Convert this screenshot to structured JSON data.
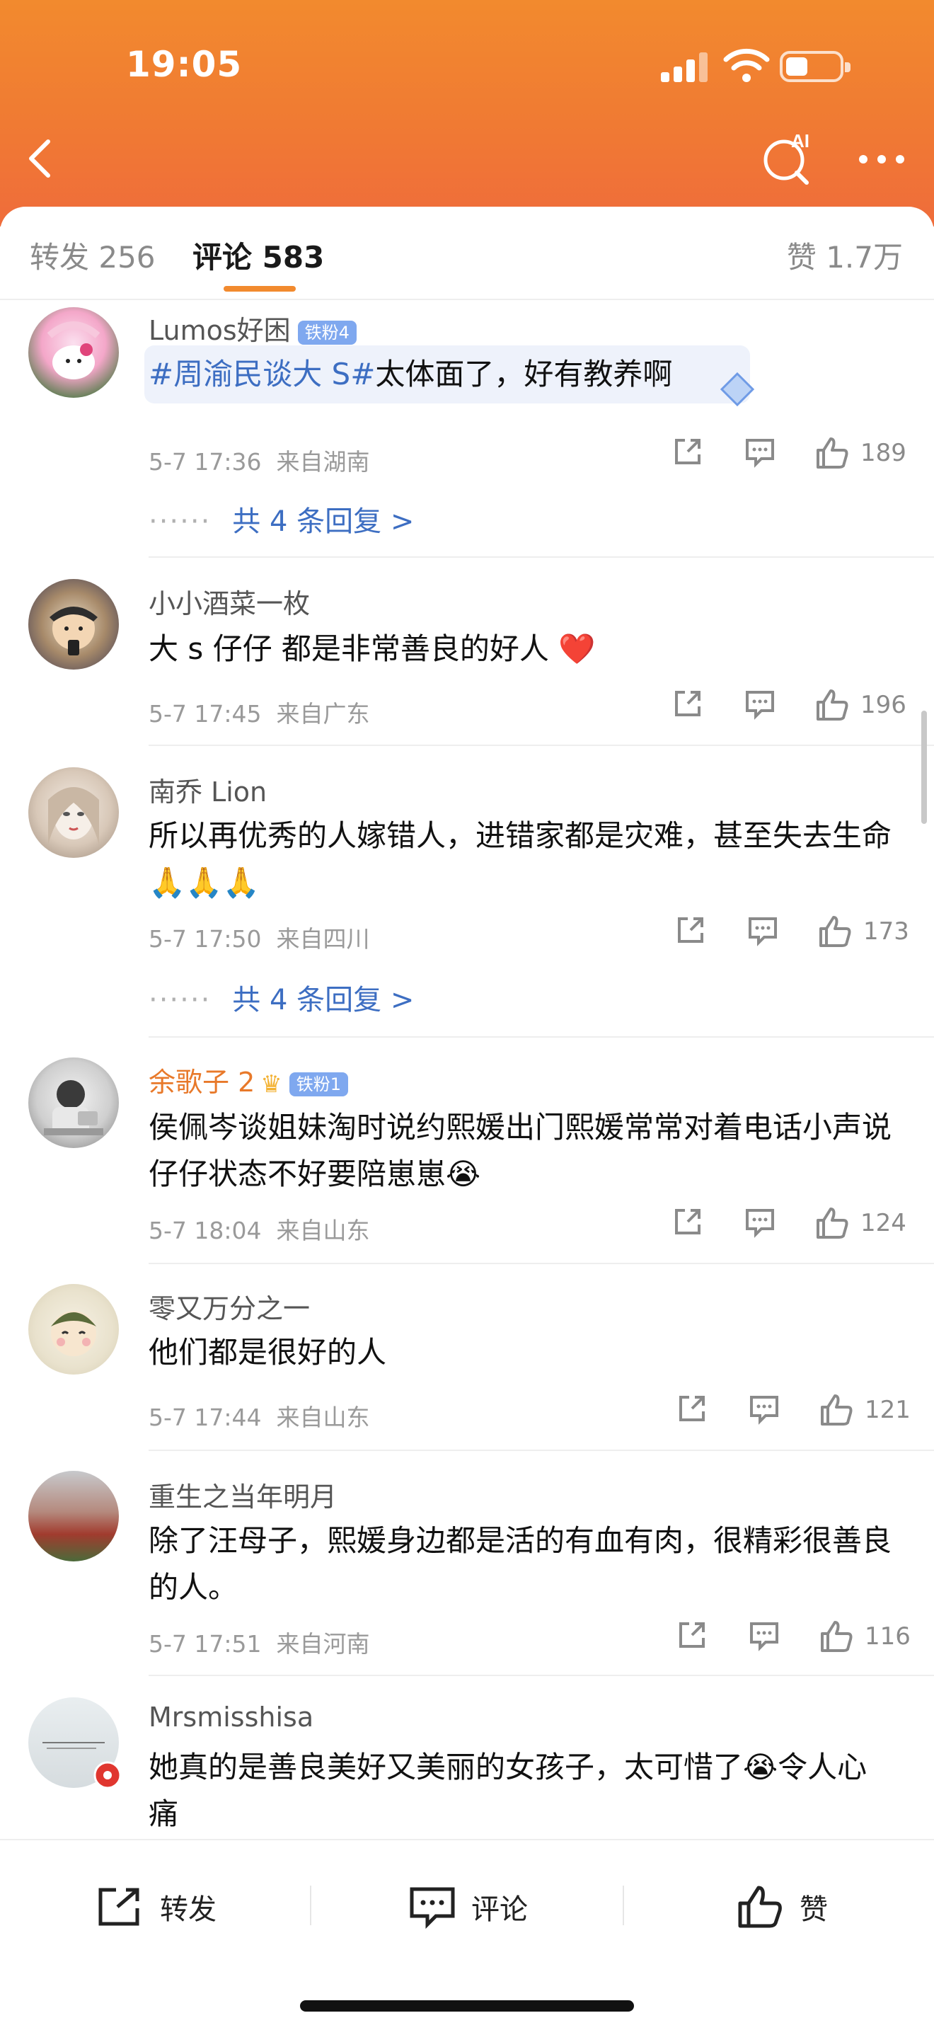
{
  "status_bar": {
    "time": "19:05"
  },
  "tabs": {
    "repost": "转发 256",
    "comment": "评论 583",
    "like": "赞 1.7万"
  },
  "comments": [
    {
      "username": "Lumos好困",
      "badge": "铁粉4",
      "hashtag": "#周渝民谈大 S#",
      "text": "太体面了，好有教养啊",
      "time": "5-7 17:36",
      "location": "来自湖南",
      "likes": "189",
      "replies": "共 4 条回复 >"
    },
    {
      "username": "小小酒菜一枚",
      "text": "大 s 仔仔 都是非常善良的好人 ❤️",
      "time": "5-7 17:45",
      "location": "来自广东",
      "likes": "196"
    },
    {
      "username": "南乔 Lion",
      "text": "所以再优秀的人嫁错人，进错家都是灾难，甚至失去生命🙏🙏🙏",
      "time": "5-7 17:50",
      "location": "来自四川",
      "likes": "173",
      "replies": "共 4 条回复 >"
    },
    {
      "username": "余歌子 2",
      "badge": "铁粉1",
      "text": "侯佩岑谈姐妹淘时说约熙媛出门熙媛常常对着电话小声说仔仔状态不好要陪崽崽😭",
      "time": "5-7 18:04",
      "location": "来自山东",
      "likes": "124"
    },
    {
      "username": "零又万分之一",
      "text": "他们都是很好的人",
      "time": "5-7 17:44",
      "location": "来自山东",
      "likes": "121"
    },
    {
      "username": "重生之当年明月",
      "text": "除了汪母子，熙媛身边都是活的有血有肉，很精彩很善良的人。",
      "time": "5-7 17:51",
      "location": "来自河南",
      "likes": "116"
    },
    {
      "username": "Mrsmisshisa",
      "text": "她真的是善良美好又美丽的女孩子，太可惜了😭令人心痛"
    }
  ],
  "bottom_bar": {
    "repost": "转发",
    "comment": "评论",
    "like": "赞"
  },
  "colors": {
    "header_orange": "#f28a2e",
    "link_blue": "#3d6ec2",
    "username_orange": "#e8792a"
  }
}
